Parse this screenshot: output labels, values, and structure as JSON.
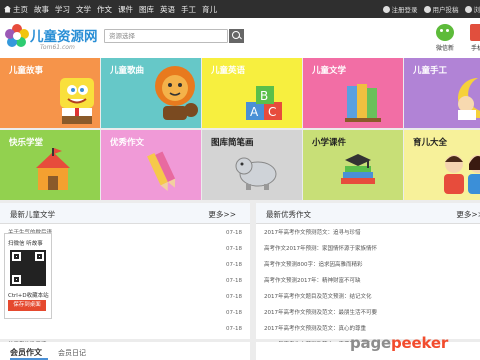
{
  "topnav": {
    "items": [
      "主页",
      "故事",
      "学习",
      "文学",
      "作文",
      "课件",
      "图库",
      "英语",
      "手工",
      "育儿"
    ]
  },
  "toplinks": {
    "register": "注册登录",
    "user": "用户投稿",
    "other": "浏"
  },
  "header": {
    "logo_text": "儿童资源网",
    "logo_sub": "Tom61.com",
    "search_placeholder": "资源选择",
    "wechat_label": "微信新",
    "mobile_label": "手机"
  },
  "tiles": [
    {
      "label": "儿童故事",
      "color": "#f6944a"
    },
    {
      "label": "儿童歌曲",
      "color": "#66c8c8"
    },
    {
      "label": "儿童英语",
      "color": "#f7ef3f"
    },
    {
      "label": "儿童文学",
      "color": "#f26ea5"
    },
    {
      "label": "儿童手工",
      "color": "#b183d6"
    },
    {
      "label": "快乐学堂",
      "color": "#92d14f"
    },
    {
      "label": "优秀作文",
      "color": "#f09ad7"
    },
    {
      "label": "图库简笔画",
      "color": "#d4d4d4"
    },
    {
      "label": "小学课件",
      "color": "#c8df77"
    },
    {
      "label": "育儿大全",
      "color": "#f7f19a"
    }
  ],
  "left_panel": {
    "title": "最新儿童文学",
    "more": "更多>>",
    "rows": [
      {
        "title": "关于生气的歇后语",
        "date": "07-18"
      },
      {
        "title": "",
        "date": "07-18"
      },
      {
        "title": "",
        "date": "07-18"
      },
      {
        "title": "",
        "date": "07-18"
      },
      {
        "title": "",
        "date": "07-18"
      },
      {
        "title": "",
        "date": "07-18"
      },
      {
        "title": "",
        "date": "07-18"
      },
      {
        "title": "关于型的歇后语",
        "date": "07-18"
      }
    ]
  },
  "right_panel": {
    "title": "最新优秀作文",
    "more": "更多>>",
    "rows": [
      {
        "title": "2017年高考作文预测范文：追寻与珍惜"
      },
      {
        "title": "高考作文2017年预测：家国情怀源于家族情怀"
      },
      {
        "title": "高考作文预测800字：追求因高雅而精彩"
      },
      {
        "title": "高考作文预测2017年：精神财富不可缺"
      },
      {
        "title": "2017年高考作文题目及范文预测：结记文化"
      },
      {
        "title": "2017年高考作文预测及范文：最朋生活不可要"
      },
      {
        "title": "2017年高考作文预测及范文：真心的尊重"
      },
      {
        "title": "2017年高考作文预测及范文：素质都去哪儿啦"
      }
    ]
  },
  "qr": {
    "line1": "扫微信 听故事",
    "line2": "Ctrl+D收藏本站",
    "button": "保存到桌面"
  },
  "bottom": {
    "tab_active": "会员作文",
    "tab_other": "会员日记"
  },
  "watermark": {
    "part1": "page",
    "part2": "peeker"
  }
}
